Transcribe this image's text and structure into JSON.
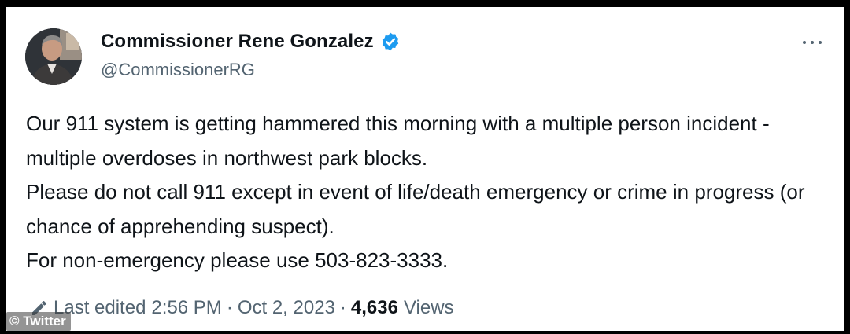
{
  "tweet": {
    "author": {
      "display_name": "Commissioner Rene Gonzalez",
      "handle": "@CommissionerRG",
      "verified": true,
      "avatar_icon": "profile-photo"
    },
    "text_lines": [
      "Our 911 system is getting hammered this morning with a multiple person incident - multiple overdoses in northwest park blocks.",
      "Please do not call 911 except in event of life/death emergency or crime in progress (or chance of apprehending suspect).",
      "For non-emergency please use 503-823-3333."
    ],
    "meta": {
      "edited_label": "Last edited",
      "time": "2:56 PM",
      "separator": "·",
      "date": "Oct 2, 2023",
      "views_count": "4,636",
      "views_label": "Views"
    },
    "more_icon": "more-horizontal-icon"
  },
  "watermark": "© Twitter",
  "colors": {
    "text_primary": "#0f1419",
    "text_secondary": "#536471",
    "verified_blue": "#1d9bf0",
    "frame": "#000000"
  }
}
